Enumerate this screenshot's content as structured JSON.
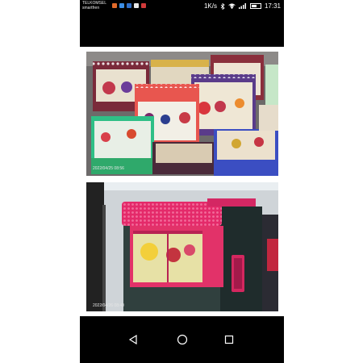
{
  "status_bar": {
    "carrier": "TELKOMSEL",
    "carrier_sub": "smartfren",
    "network_speed": "1K/s",
    "clock": "17:31",
    "battery_level": 0.55,
    "notification_icon_colors": [
      "#e06a2a",
      "#3b8ee6",
      "#2f6fc9",
      "#e8e8e8",
      "#d13a3a"
    ]
  },
  "photos": {
    "top": {
      "timestamp": "2022/04/25 08:56"
    },
    "bottom": {
      "timestamp": "2022/04/26 08:40"
    }
  },
  "nav_bar": {
    "back_icon": "back-triangle-icon",
    "home_icon": "home-circle-icon",
    "recents_icon": "recents-square-icon"
  }
}
